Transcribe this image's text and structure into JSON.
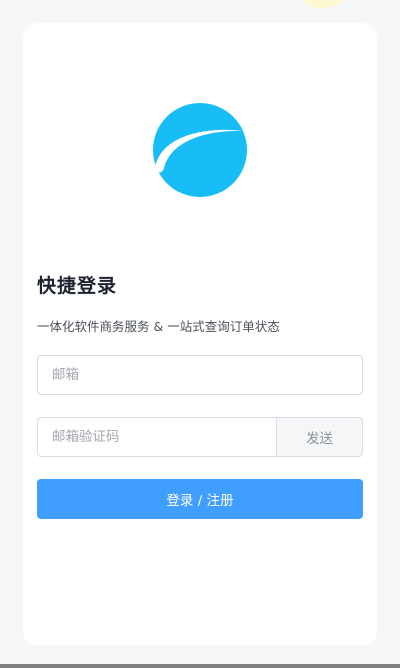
{
  "login": {
    "title": "快捷登录",
    "subtitle": "一体化软件商务服务 & 一站式查询订单状态",
    "email_placeholder": "邮箱",
    "code_placeholder": "邮箱验证码",
    "send_label": "发送",
    "submit_label": "登录 / 注册"
  },
  "logo": {
    "icon": "sphere-logo-icon",
    "color": "#18bdf6"
  },
  "colors": {
    "primary": "#409efe",
    "background": "#f6f7f9",
    "card": "#ffffff",
    "title": "#1d2230"
  }
}
